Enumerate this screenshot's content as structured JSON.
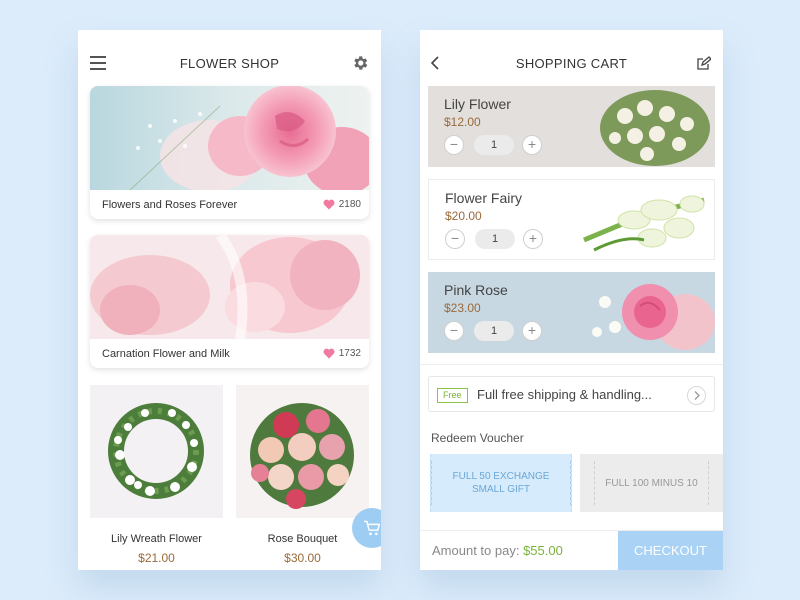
{
  "shop": {
    "title": "FLOWER SHOP",
    "features": [
      {
        "caption": "Flowers and Roses Forever",
        "likes": "2180"
      },
      {
        "caption": "Carnation Flower and Milk",
        "likes": "1732"
      }
    ],
    "products": [
      {
        "name": "Lily Wreath Flower",
        "price": "$21.00"
      },
      {
        "name": "Rose Bouquet",
        "price": "$30.00"
      }
    ]
  },
  "cart": {
    "title": "SHOPPING CART",
    "items": [
      {
        "name": "Lily Flower",
        "price": "$12.00",
        "qty": "1"
      },
      {
        "name": "Flower Fairy",
        "price": "$20.00",
        "qty": "1"
      },
      {
        "name": "Pink Rose",
        "price": "$23.00",
        "qty": "1"
      }
    ],
    "shipping": {
      "tag": "Free",
      "text": "Full free shipping & handling..."
    },
    "voucher_title": "Redeem Voucher",
    "vouchers": [
      {
        "label": "FULL 50 EXCHANGE SMALL GIFT"
      },
      {
        "label": "FULL 100 MINUS 10"
      }
    ],
    "amount_label": "Amount to pay:",
    "amount_value": "$55.00",
    "checkout_label": "CHECKOUT"
  },
  "colors": {
    "background": "#dcecfb",
    "accent_blue": "#a9d2f4",
    "price_brown": "#9a6a3b",
    "free_green": "#7ab23a",
    "heart_pink": "#f07aa0"
  },
  "icons": [
    "menu-icon",
    "settings-gear-icon",
    "heart-icon",
    "cart-icon",
    "back-chevron-icon",
    "edit-icon",
    "chevron-right-icon",
    "minus-icon",
    "plus-icon"
  ]
}
